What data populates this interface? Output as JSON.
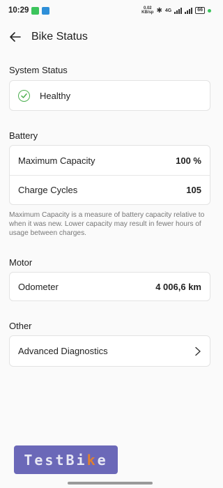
{
  "statusbar": {
    "time": "10:29",
    "speed_value": "0.02",
    "speed_unit": "KB/sp",
    "network": "4G",
    "battery": "66"
  },
  "header": {
    "title": "Bike Status"
  },
  "system_status": {
    "section_title": "System Status",
    "status_label": "Healthy"
  },
  "battery": {
    "section_title": "Battery",
    "rows": [
      {
        "label": "Maximum Capacity",
        "value": "100 %"
      },
      {
        "label": "Charge Cycles",
        "value": "105"
      }
    ],
    "note": "Maximum Capacity is a measure of battery capacity relative to when it was new. Lower capacity may result in fewer hours of usage between charges."
  },
  "motor": {
    "section_title": "Motor",
    "odometer_label": "Odometer",
    "odometer_value": "4 006,6 km"
  },
  "other": {
    "section_title": "Other",
    "advanced_label": "Advanced Diagnostics"
  },
  "brand": {
    "text_before": "TestBi",
    "text_accent": "k",
    "text_after": "e"
  },
  "colors": {
    "status_ok": "#4caf50",
    "brand_bg": "#6b68b8",
    "background": "#fafafa"
  }
}
